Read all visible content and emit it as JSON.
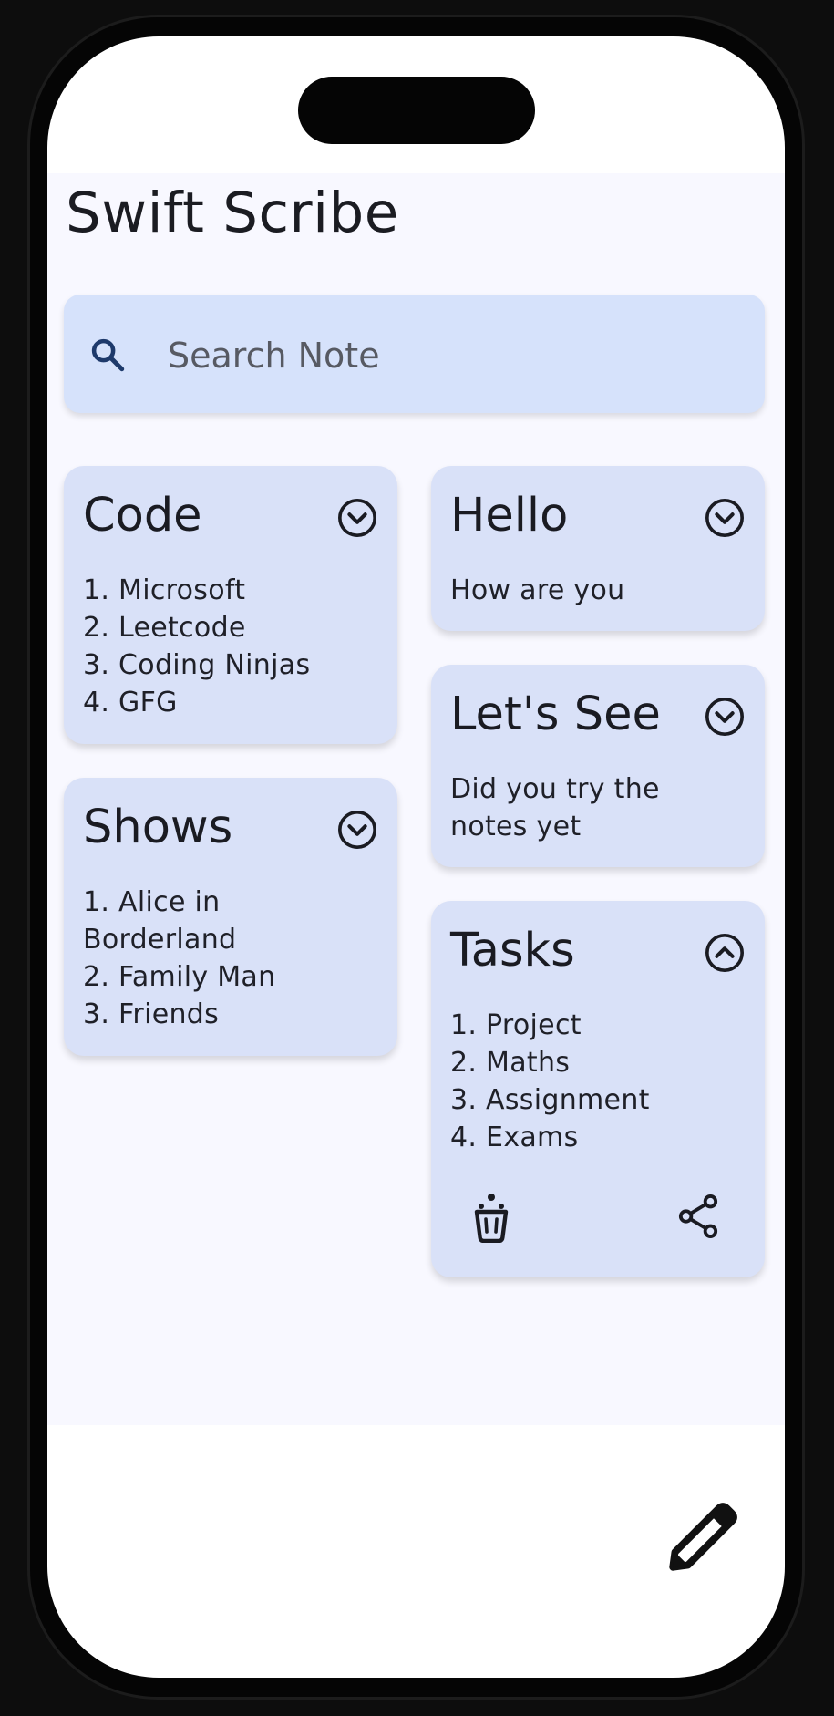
{
  "app": {
    "title": "Swift Scribe"
  },
  "search": {
    "placeholder": "Search Note",
    "value": ""
  },
  "notes": [
    {
      "title": "Code",
      "body": "1. Microsoft\n2. Leetcode\n3. Coding Ninjas\n4. GFG",
      "expanded": false
    },
    {
      "title": "Hello",
      "body": "How are you",
      "expanded": false
    },
    {
      "title": "Let's See",
      "body": "Did you try the\nnotes yet",
      "expanded": false
    },
    {
      "title": "Shows",
      "body": "1. Alice in\nBorderland\n2. Family Man\n3. Friends",
      "expanded": false
    },
    {
      "title": "Tasks",
      "body": "1. Project\n2. Maths\n3. Assignment\n4. Exams",
      "expanded": true
    }
  ],
  "icons": {
    "search": "search-icon",
    "collapsed": "chevron-down-circle-icon",
    "expanded": "chevron-up-circle-icon",
    "delete": "delete-icon",
    "share": "share-icon",
    "new_note": "pencil-icon"
  },
  "colors": {
    "background": "#f8f8ff",
    "search_bg": "#d6e2fb",
    "card_bg": "#d9e1f8",
    "text": "#1a1b22",
    "search_icon": "#1e3a6b"
  }
}
